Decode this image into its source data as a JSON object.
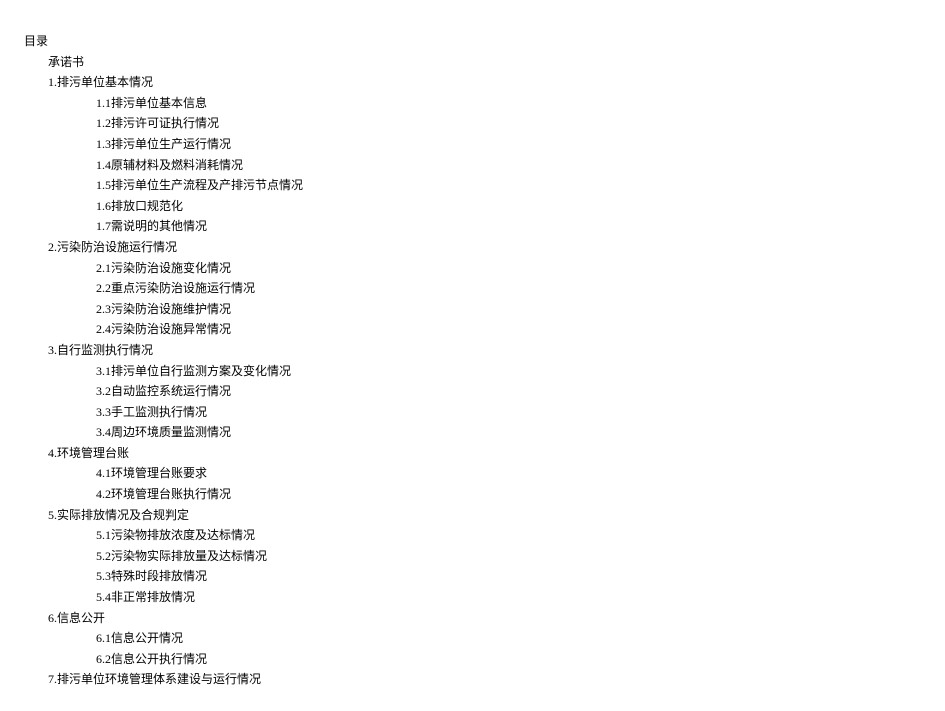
{
  "title": "目录",
  "pledge": {
    "label": "承诺书"
  },
  "sections": [
    {
      "label": "1.排污单位基本情况",
      "items": [
        {
          "label": "1.1排污单位基本信息"
        },
        {
          "label": "1.2排污许可证执行情况"
        },
        {
          "label": "1.3排污单位生产运行情况"
        },
        {
          "label": "1.4原辅材料及燃料消耗情况"
        },
        {
          "label": "1.5排污单位生产流程及产排污节点情况"
        },
        {
          "label": "1.6排放口规范化"
        },
        {
          "label": "1.7需说明的其他情况"
        }
      ]
    },
    {
      "label": "2.污染防治设施运行情况",
      "items": [
        {
          "label": "2.1污染防治设施变化情况"
        },
        {
          "label": "2.2重点污染防治设施运行情况"
        },
        {
          "label": "2.3污染防治设施维护情况"
        },
        {
          "label": "2.4污染防治设施异常情况"
        }
      ]
    },
    {
      "label": "3.自行监测执行情况",
      "items": [
        {
          "label": "3.1排污单位自行监测方案及变化情况"
        },
        {
          "label": "3.2自动监控系统运行情况"
        },
        {
          "label": "3.3手工监测执行情况"
        },
        {
          "label": "3.4周边环境质量监测情况"
        }
      ]
    },
    {
      "label": "4.环境管理台账",
      "items": [
        {
          "label": "4.1环境管理台账要求"
        },
        {
          "label": "4.2环境管理台账执行情况"
        }
      ]
    },
    {
      "label": "5.实际排放情况及合规判定",
      "items": [
        {
          "label": "5.1污染物排放浓度及达标情况"
        },
        {
          "label": "5.2污染物实际排放量及达标情况"
        },
        {
          "label": "5.3特殊时段排放情况"
        },
        {
          "label": "5.4非正常排放情况"
        }
      ]
    },
    {
      "label": "6.信息公开",
      "items": [
        {
          "label": "6.1信息公开情况"
        },
        {
          "label": "6.2信息公开执行情况"
        }
      ]
    },
    {
      "label": "7.排污单位环境管理体系建设与运行情况",
      "items": []
    }
  ]
}
